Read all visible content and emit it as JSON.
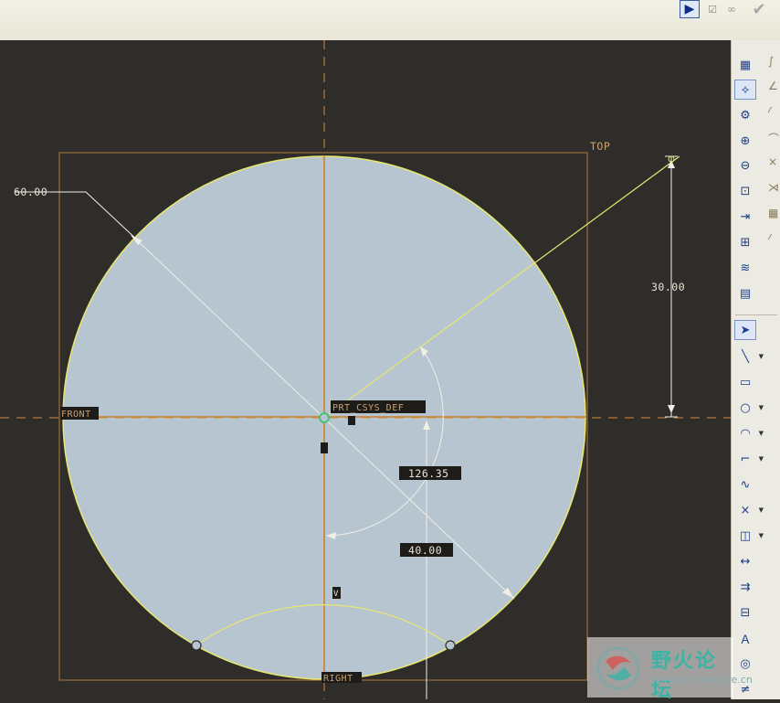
{
  "topbar": {
    "play_icon": "play-icon",
    "check_small_icon": "checkbox-icon",
    "glasses_icon": "glasses-icon",
    "done_icon": "checkmark-icon"
  },
  "sketch": {
    "dimensions": {
      "diameter": "60.00",
      "vertical": "30.00",
      "angle": "126.35",
      "radius": "40.00"
    },
    "datum_labels": {
      "top": "TOP",
      "front": "FRONT",
      "right": "RIGHT",
      "csys": "PRT_CSYS_DEF"
    },
    "constraint_marks": {
      "h": "H",
      "v": "V"
    },
    "colors": {
      "background": "#2f2d29",
      "fill": "#b7c5d0",
      "sketch": "#e8e870",
      "datum": "#d18a3a",
      "dimension": "#f0efe6"
    }
  },
  "toolbar": {
    "tools": [
      "sketch-setup-icon",
      "sketch-view-icon",
      "orient-icon",
      "zoom-in-icon",
      "zoom-out-icon",
      "refit-icon",
      "reference-icon",
      "text-dim-icon",
      "layers-icon",
      "snapshot-icon",
      "select-arrow-icon",
      "line-icon",
      "rectangle-icon",
      "circle-icon",
      "arc-icon",
      "fillet-icon",
      "spline-icon",
      "point-icon",
      "offset-icon",
      "dimension-icon",
      "modify-icon",
      "constraint-icon",
      "text-icon",
      "palette-icon",
      "trim-icon"
    ]
  },
  "watermark": {
    "title": "野火论坛",
    "url": "www.proewildfire.cn"
  }
}
